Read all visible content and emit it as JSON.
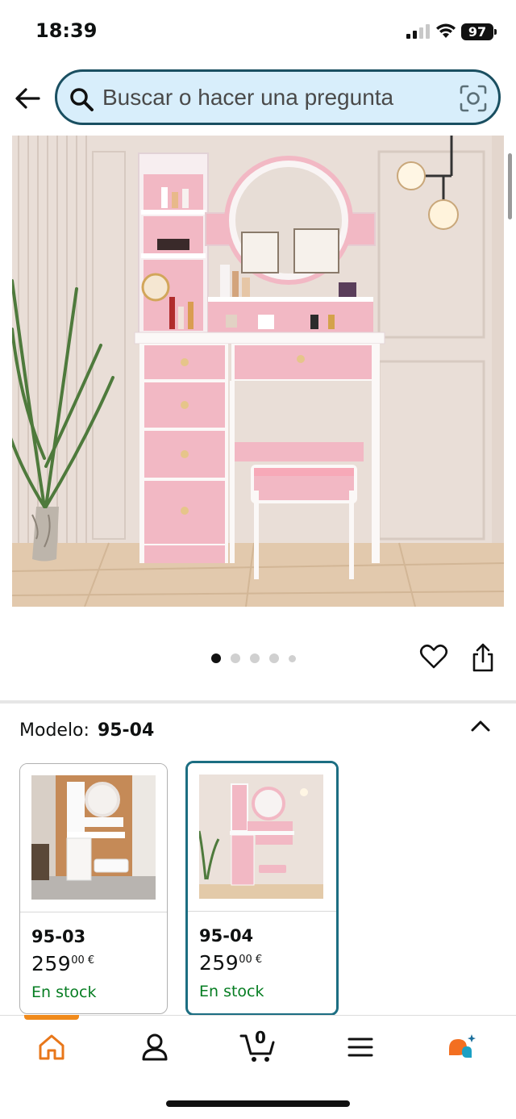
{
  "status_bar": {
    "time": "18:39",
    "battery": "97",
    "icons": [
      "signal-icon",
      "wifi-icon",
      "battery-icon"
    ]
  },
  "header": {
    "back_icon": "back-arrow-icon",
    "search": {
      "placeholder": "Buscar o hacer una pregunta",
      "value": "",
      "left_icon": "search-icon",
      "right_icon": "camera-lens-icon"
    }
  },
  "gallery": {
    "image_subject": "pink-vanity-table-with-led-mirror-and-stool",
    "dot_count": 5,
    "active_dot": 0,
    "actions": [
      "heart-icon",
      "share-icon"
    ]
  },
  "model_selector": {
    "label": "Modelo:",
    "selected_value": "95-04",
    "toggle_icon": "chevron-up-icon",
    "variants": [
      {
        "code": "95-03",
        "price_whole": "259",
        "price_cents": "00 €",
        "stock": "En stock",
        "selected": false
      },
      {
        "code": "95-04",
        "price_whole": "259",
        "price_cents": "00 €",
        "stock": "En stock",
        "selected": true
      }
    ]
  },
  "bottom_nav": {
    "items": [
      "home-icon",
      "account-icon",
      "cart-icon",
      "menu-icon",
      "rufus-assistant-icon"
    ],
    "cart_count": "0",
    "active_item": "home-icon"
  },
  "colors": {
    "search_border": "#1a4f61",
    "search_fill": "#d8eefb",
    "selected_card_border": "#1c6e82",
    "stock_green": "#067d22",
    "nav_accent": "#f08a1c",
    "vanity_pink": "#f2b8c4"
  }
}
